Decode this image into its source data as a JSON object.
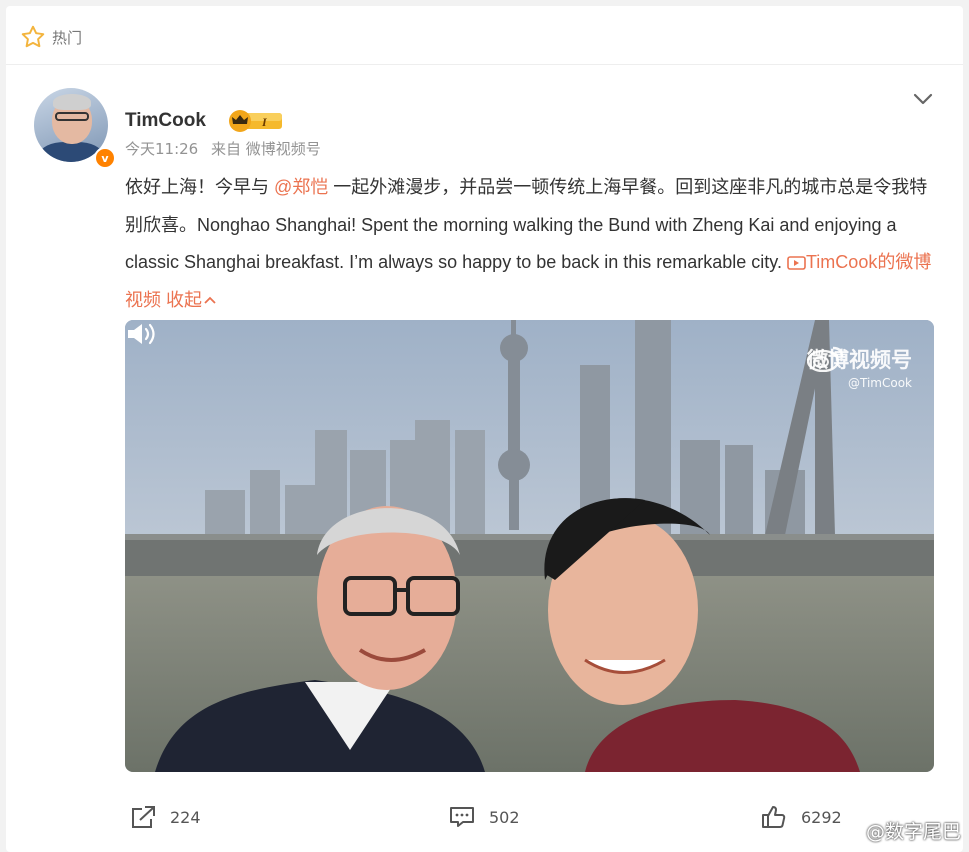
{
  "header": {
    "label": "热门"
  },
  "post": {
    "author": "TimCook",
    "verified_mark": "v",
    "time": "今天11:26",
    "source": "来自 微博视频号",
    "text_part1": "依好上海！今早与 ",
    "mention": "@郑恺",
    "text_part2": " 一起外滩漫步，并品尝一顿传统上海早餐。回到这座非凡的城市总是令我特别欣喜。Nonghao Shanghai! Spent the morning walking the Bund with Zheng Kai and enjoying a classic Shanghai breakfast. I’m always so happy to be back in this remarkable city. ",
    "video_link": "TimCook的微博视频",
    "collapse": "收起",
    "badge_text": "I"
  },
  "media": {
    "watermark_title": "微博视频号",
    "watermark_handle": "@TimCook"
  },
  "actions": {
    "share_count": "224",
    "comment_count": "502",
    "like_count": "6292"
  },
  "site_watermark": "@数字尾巴",
  "colors": {
    "accent": "#eb7350",
    "badge_gold": "#f5b92c",
    "verified_orange": "#ff8200"
  }
}
